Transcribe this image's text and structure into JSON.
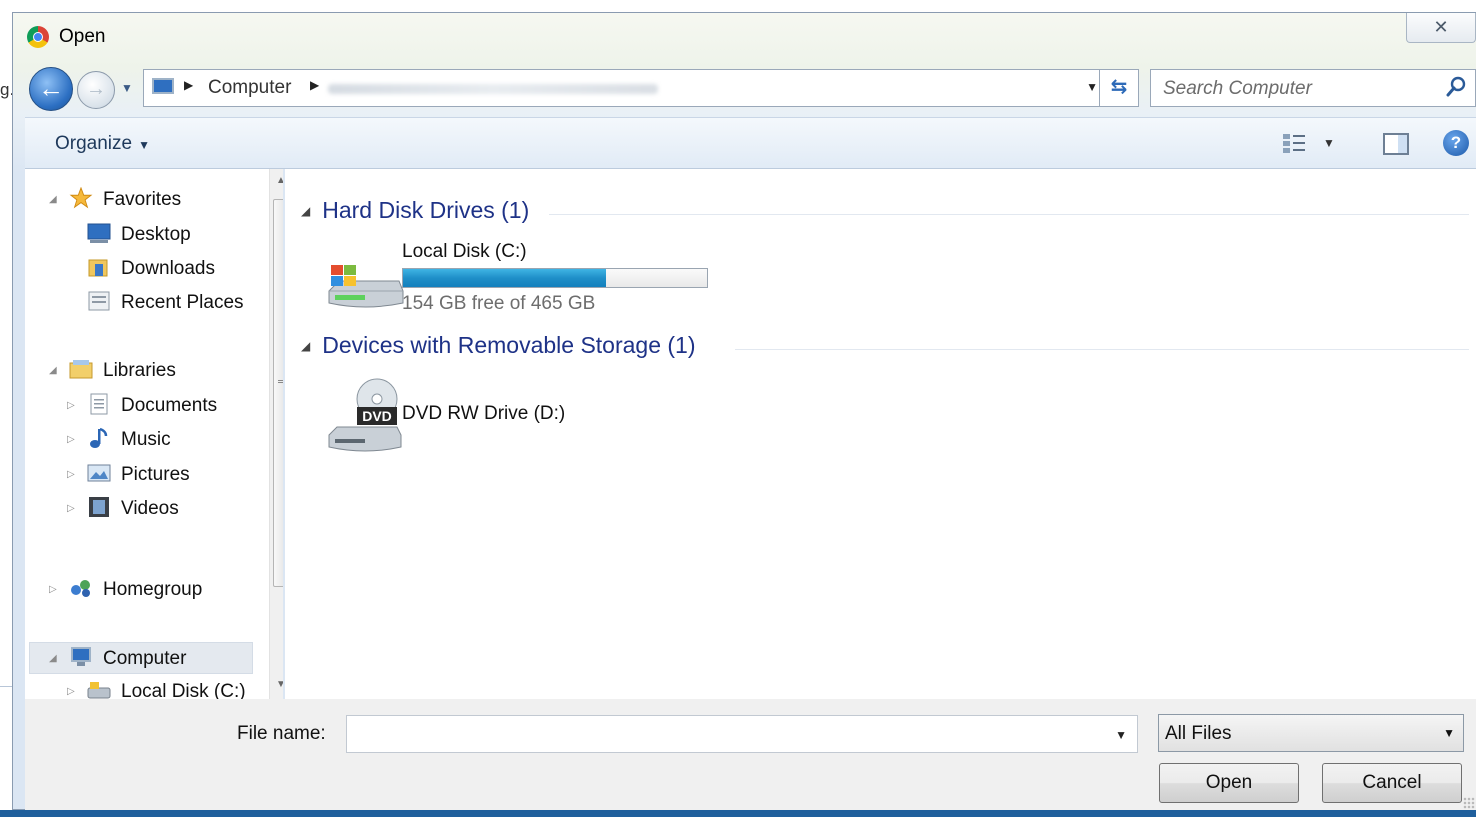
{
  "window": {
    "title": "Open",
    "close_glyph": "✕"
  },
  "navigation": {
    "back_icon": "arrow-left-icon",
    "forward_icon": "arrow-right-icon",
    "breadcrumb": [
      "Computer"
    ],
    "search_placeholder": "Search Computer"
  },
  "toolbar": {
    "organize_label": "Organize"
  },
  "nav_pane": {
    "favorites": {
      "label": "Favorites",
      "items": [
        {
          "label": "Desktop",
          "icon": "desktop-icon"
        },
        {
          "label": "Downloads",
          "icon": "downloads-icon"
        },
        {
          "label": "Recent Places",
          "icon": "recent-places-icon"
        }
      ]
    },
    "libraries": {
      "label": "Libraries",
      "items": [
        {
          "label": "Documents",
          "icon": "documents-icon"
        },
        {
          "label": "Music",
          "icon": "music-icon"
        },
        {
          "label": "Pictures",
          "icon": "pictures-icon"
        },
        {
          "label": "Videos",
          "icon": "videos-icon"
        }
      ]
    },
    "homegroup": {
      "label": "Homegroup"
    },
    "computer": {
      "label": "Computer",
      "items": [
        {
          "label": "Local Disk (C:)",
          "icon": "local-disk-icon"
        }
      ]
    }
  },
  "content": {
    "groups": [
      {
        "title": "Hard Disk Drives (1)"
      },
      {
        "title": "Devices with Removable Storage (1)"
      }
    ],
    "drives": {
      "local_disk": {
        "name": "Local Disk (C:)",
        "free_text": "154 GB free of 465 GB",
        "used_fraction": 0.669
      },
      "dvd": {
        "name": "DVD RW Drive (D:)",
        "icon_label": "DVD"
      }
    }
  },
  "bottom": {
    "filename_label": "File name:",
    "filename_value": "",
    "filetype_selected": "All Files",
    "open_label": "Open",
    "cancel_label": "Cancel"
  },
  "colors": {
    "accent_blue": "#1e3287",
    "capacity_fill": "#1f8fc8"
  }
}
